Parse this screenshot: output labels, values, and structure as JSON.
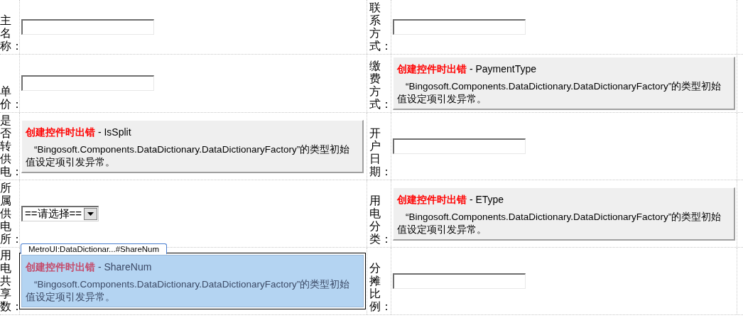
{
  "rows": [
    {
      "cells": [
        {
          "label": "主名称：",
          "control": {
            "kind": "text",
            "selected": false
          }
        },
        {
          "label": "联系方式：",
          "control": {
            "kind": "text",
            "selected": false
          }
        }
      ]
    },
    {
      "cells": [
        {
          "label": "单价：",
          "control": {
            "kind": "text",
            "selected": false
          }
        },
        {
          "label": "缴费方式：",
          "control": {
            "kind": "error",
            "title": "创建控件时出错",
            "field": "- PaymentType",
            "message": "“Bingosoft.Components.DataDictionary.DataDictionaryFactory”的类型初始值设定项引发异常。",
            "selected": false
          }
        }
      ]
    },
    {
      "cells": [
        {
          "label": "是否转供电：",
          "control": {
            "kind": "error",
            "title": "创建控件时出错",
            "field": "- IsSplit",
            "message": "“Bingosoft.Components.DataDictionary.DataDictionaryFactory”的类型初始值设定项引发异常。",
            "selected": false
          }
        },
        {
          "label": "开户日期：",
          "control": {
            "kind": "text",
            "selected": false
          }
        }
      ]
    },
    {
      "cells": [
        {
          "label": "所属供电所：",
          "control": {
            "kind": "select",
            "value": "==请选择==",
            "selected": false
          }
        },
        {
          "label": "用电分类：",
          "control": {
            "kind": "error",
            "title": "创建控件时出错",
            "field": "- EType",
            "message": "“Bingosoft.Components.DataDictionary.DataDictionaryFactory”的类型初始值设定项引发异常。",
            "selected": false
          }
        }
      ]
    },
    {
      "cells": [
        {
          "label": "用电共享数：",
          "control": {
            "kind": "error",
            "title": "创建控件时出错",
            "field": "- ShareNum",
            "message": "“Bingosoft.Components.DataDictionary.DataDictionaryFactory”的类型初始值设定项引发异常。",
            "selected": true,
            "tag": "MetroUI:DataDictionar...#ShareNum"
          }
        },
        {
          "label": "分摊比例：",
          "control": {
            "kind": "text",
            "selected": false
          }
        }
      ]
    }
  ]
}
